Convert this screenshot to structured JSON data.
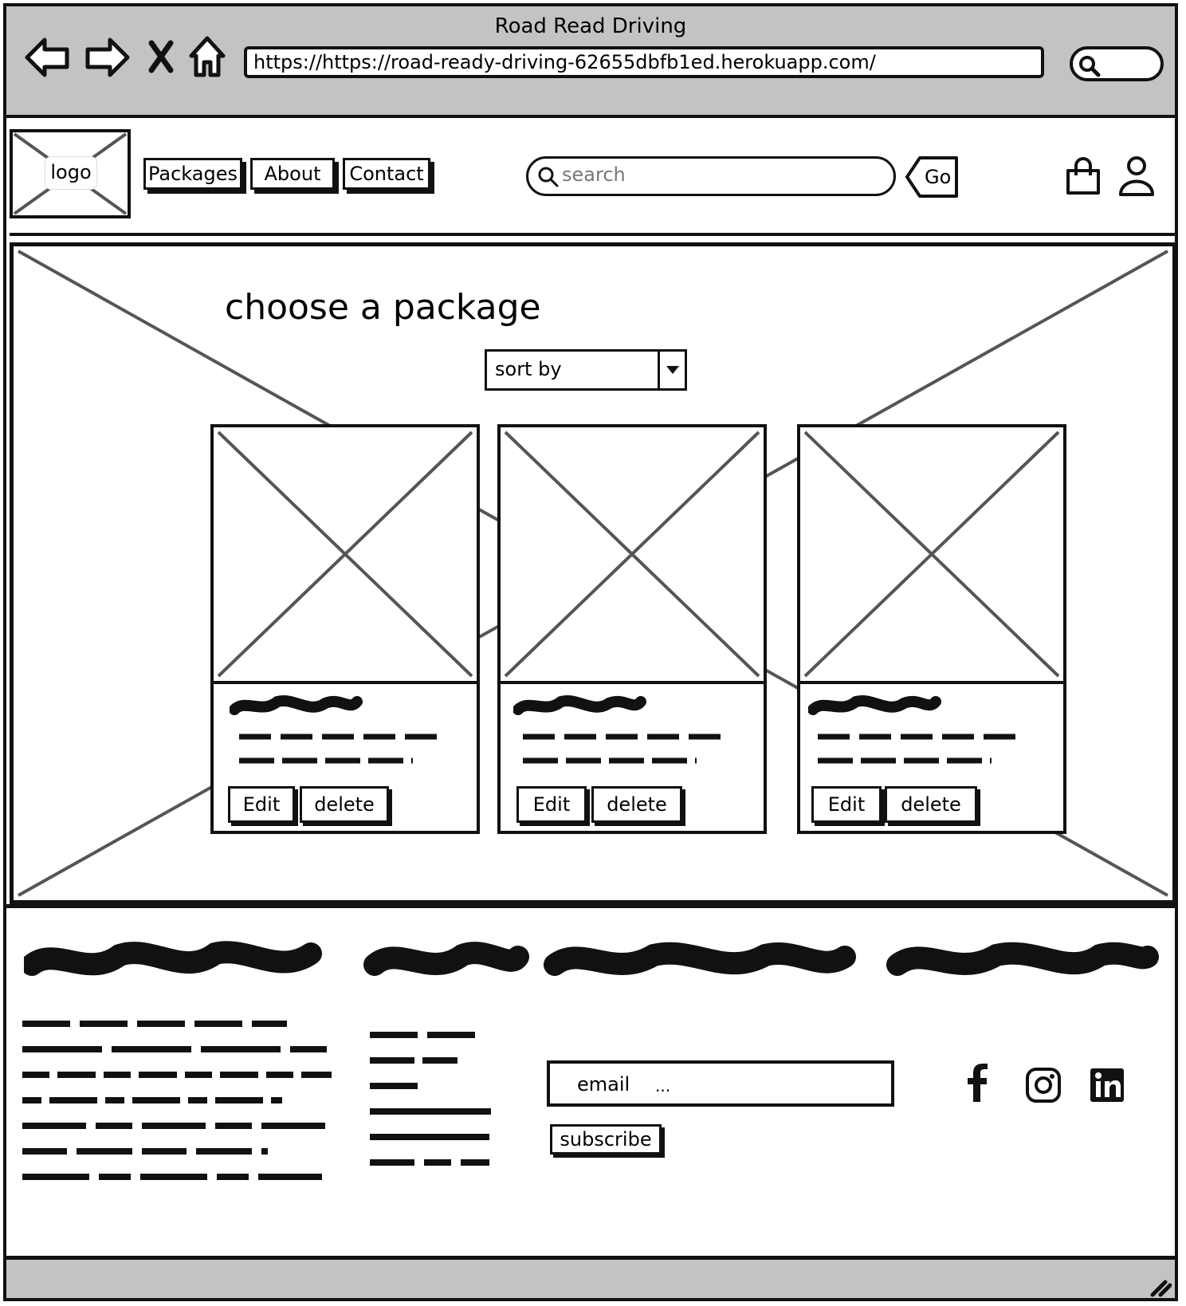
{
  "window": {
    "title": "Road Read Driving",
    "url": "https://https://road-ready-driving-62655dbfb1ed.herokuapp.com/"
  },
  "icons": {
    "back": "back-arrow-icon",
    "forward": "forward-arrow-icon",
    "stop": "close-icon",
    "home": "home-icon",
    "browser_search": "search-icon",
    "cart": "shopping-bag-icon",
    "user": "user-icon",
    "facebook": "facebook-icon",
    "instagram": "instagram-icon",
    "linkedin": "linkedin-icon"
  },
  "header": {
    "logo_label": "logo",
    "nav": [
      "Packages",
      "About",
      "Contact"
    ],
    "search_placeholder": "search",
    "go_label": "Go"
  },
  "main": {
    "heading": "choose a package",
    "sort_label": "sort by",
    "cards": [
      {
        "edit_label": "Edit",
        "delete_label": "delete"
      },
      {
        "edit_label": "Edit",
        "delete_label": "delete"
      },
      {
        "edit_label": "Edit",
        "delete_label": "delete"
      }
    ]
  },
  "footer": {
    "email_placeholder": "email",
    "email_dots": "...",
    "subscribe_label": "subscribe"
  }
}
